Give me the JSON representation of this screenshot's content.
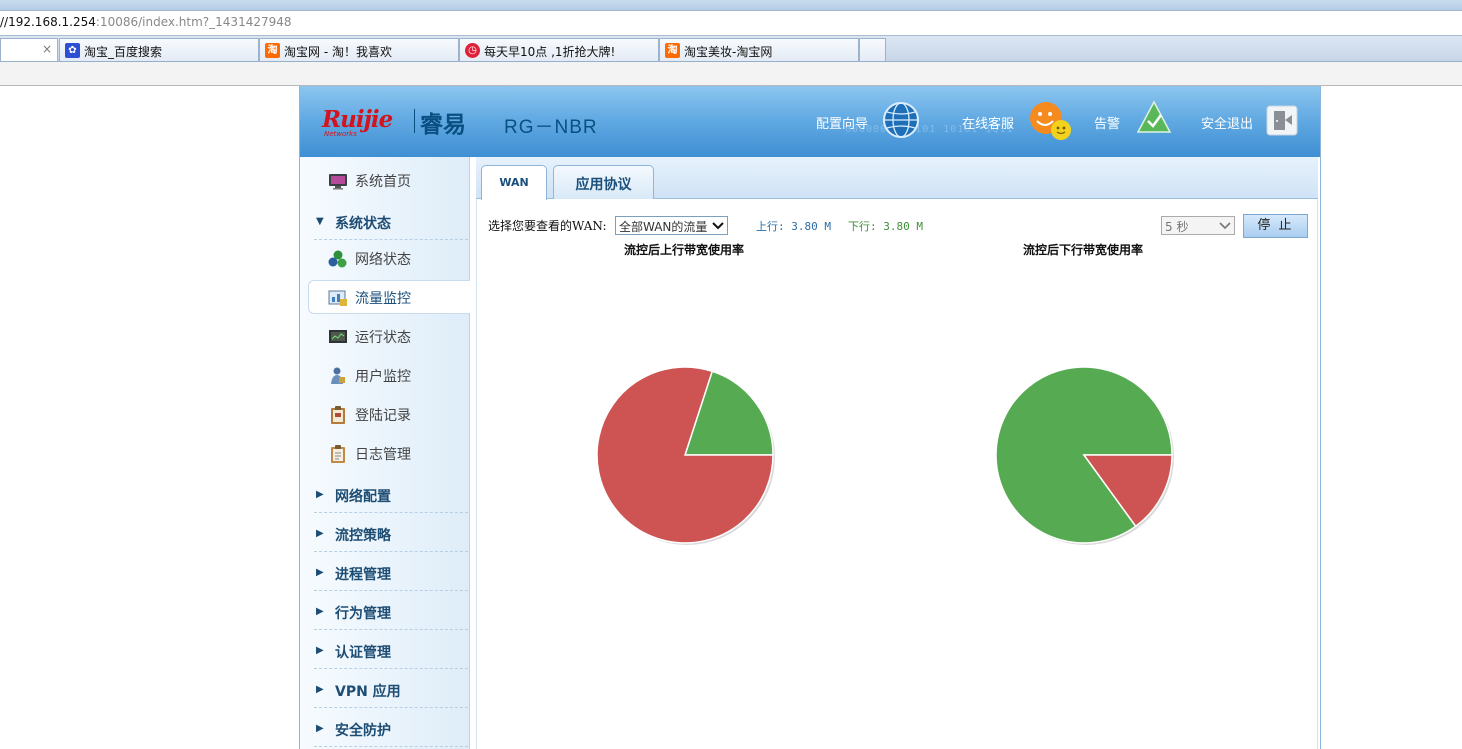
{
  "browser": {
    "address_host": "//192.168.1.254",
    "address_rest": ":10086/index.htm?_1431427948",
    "tabs": [
      {
        "label": "",
        "close": "×"
      },
      {
        "label": "淘宝_百度搜索"
      },
      {
        "label": "淘宝网 - 淘！我喜欢"
      },
      {
        "label": "每天早10点 ,1折抢大牌!"
      },
      {
        "label": "淘宝美妆-淘宝网"
      }
    ],
    "favicon_text": "淘"
  },
  "header": {
    "brand": "Ruijie",
    "brand_sub": "Networks",
    "brand_cn": "睿易",
    "product": "RG－NBR",
    "deco": "0000001 10101 10101 1Q11",
    "links": {
      "wizard": "配置向导",
      "support": "在线客服",
      "alarm": "告警",
      "logout": "安全退出"
    }
  },
  "sidebar": {
    "home": "系统首页",
    "group_status": "系统状态",
    "status_items": [
      "网络状态",
      "流量监控",
      "运行状态",
      "用户监控",
      "登陆记录",
      "日志管理"
    ],
    "groups": [
      "网络配置",
      "流控策略",
      "进程管理",
      "行为管理",
      "认证管理",
      "VPN 应用",
      "安全防护"
    ]
  },
  "tabs": {
    "wan": "WAN",
    "protocol": "应用协议"
  },
  "controls": {
    "select_label": "选择您要查看的WAN:",
    "wan_select": "全部WAN的流量",
    "up_label": "上行: 3.80 M",
    "down_label": "下行: 3.80 M",
    "interval": "5 秒",
    "stop": "停 止"
  },
  "colors": {
    "red": "#cd5452",
    "green": "#55aa52",
    "up_text": "#2b6da6",
    "down_text": "#3f8f38"
  },
  "chart_data": [
    {
      "type": "pie",
      "title": "流控后上行带宽使用率",
      "slices": [
        {
          "value": 0.2,
          "color": "#55aa52"
        },
        {
          "value": 0.8,
          "color": "#cd5452"
        }
      ]
    },
    {
      "type": "pie",
      "title": "流控后下行带宽使用率",
      "slices": [
        {
          "value": 0.85,
          "color": "#55aa52"
        },
        {
          "value": 0.15,
          "color": "#cd5452"
        }
      ]
    }
  ]
}
